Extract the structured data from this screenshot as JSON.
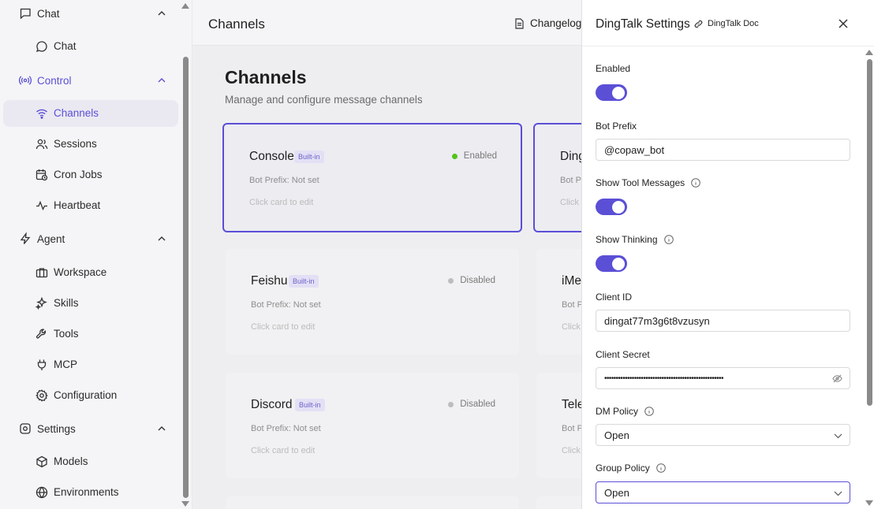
{
  "sidebar": {
    "groups": [
      {
        "label": "Chat",
        "icon": "message-square-icon",
        "items": [
          {
            "label": "Chat",
            "icon": "message-circle-icon"
          }
        ]
      },
      {
        "label": "Control",
        "icon": "radio-icon",
        "items": [
          {
            "label": "Channels",
            "icon": "wifi-icon"
          },
          {
            "label": "Sessions",
            "icon": "users-icon"
          },
          {
            "label": "Cron Jobs",
            "icon": "calendar-clock-icon"
          },
          {
            "label": "Heartbeat",
            "icon": "activity-icon"
          }
        ]
      },
      {
        "label": "Agent",
        "icon": "zap-icon",
        "items": [
          {
            "label": "Workspace",
            "icon": "briefcase-icon"
          },
          {
            "label": "Skills",
            "icon": "sparkles-icon"
          },
          {
            "label": "Tools",
            "icon": "wrench-icon"
          },
          {
            "label": "MCP",
            "icon": "plug-icon"
          },
          {
            "label": "Configuration",
            "icon": "settings-icon"
          }
        ]
      },
      {
        "label": "Settings",
        "icon": "cog-icon",
        "items": [
          {
            "label": "Models",
            "icon": "box-icon"
          },
          {
            "label": "Environments",
            "icon": "globe-icon"
          }
        ]
      }
    ]
  },
  "topbar": {
    "title": "Channels",
    "changelog": "Changelog"
  },
  "main": {
    "heading": "Channels",
    "subtitle": "Manage and configure message channels",
    "cards": [
      {
        "name": "Console",
        "badge": "Built-in",
        "status": "Enabled",
        "prefix": "Bot Prefix: Not set",
        "hint": "Click card to edit"
      },
      {
        "name": "Ding",
        "badge": "",
        "status": "",
        "prefix": "Bot P",
        "hint": "Click c"
      },
      {
        "name": "Feishu",
        "badge": "Built-in",
        "status": "Disabled",
        "prefix": "Bot Prefix: Not set",
        "hint": "Click card to edit"
      },
      {
        "name": "iMe",
        "badge": "",
        "status": "",
        "prefix": "Bot P",
        "hint": "Click"
      },
      {
        "name": "Discord",
        "badge": "Built-in",
        "status": "Disabled",
        "prefix": "Bot Prefix: Not set",
        "hint": "Click card to edit"
      },
      {
        "name": "Tele",
        "badge": "",
        "status": "",
        "prefix": "Bot P",
        "hint": "Click"
      }
    ]
  },
  "panel": {
    "title": "DingTalk Settings",
    "doc_link": "DingTalk Doc",
    "fields": {
      "enabled": {
        "label": "Enabled",
        "value": true
      },
      "bot_prefix": {
        "label": "Bot Prefix",
        "value": "@copaw_bot"
      },
      "show_tool_messages": {
        "label": "Show Tool Messages",
        "value": true
      },
      "show_thinking": {
        "label": "Show Thinking",
        "value": true
      },
      "client_id": {
        "label": "Client ID",
        "value": "dingat77m3g6t8vzusyn"
      },
      "client_secret": {
        "label": "Client Secret",
        "value": "••••••••••••••••••••••••••••••••••••••••••••••••••••"
      },
      "dm_policy": {
        "label": "DM Policy",
        "value": "Open"
      },
      "group_policy": {
        "label": "Group Policy",
        "value": "Open"
      }
    }
  },
  "colors": {
    "accent": "#5b4fd6",
    "enabled_dot": "#52c41a"
  }
}
